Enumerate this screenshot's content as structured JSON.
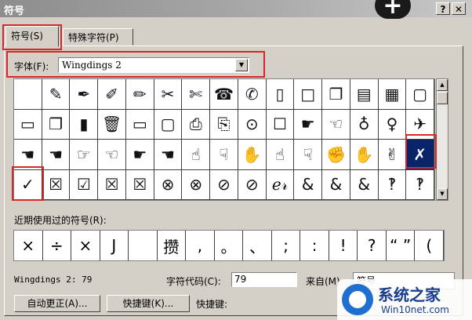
{
  "window": {
    "title": "符号",
    "help_label": "?",
    "close_label": "✕",
    "plus_label": "+"
  },
  "tabs": [
    {
      "label": "符号(S)",
      "active": true
    },
    {
      "label": "特殊字符(P)",
      "active": false
    }
  ],
  "font": {
    "label": "字体(F):",
    "value": "Wingdings 2",
    "dropdown_icon": "▼"
  },
  "symbol_grid": {
    "rows": [
      [
        " ",
        "✎",
        "✒",
        "✐",
        "✏",
        "✂",
        "✄",
        "☎",
        "✆",
        "▯",
        "□",
        "❐",
        "▤",
        "▦",
        "▢"
      ],
      [
        "▭",
        "❐",
        "▮",
        "🗑",
        "▭",
        "▢",
        "⎙",
        "⎘",
        "⊙",
        "☐",
        "☛",
        "☜",
        "♁",
        "♀",
        "✈"
      ],
      [
        "☚",
        "☚",
        "☞",
        "☜",
        "☛",
        "☚",
        "☝",
        "☟",
        "✋",
        "☝",
        "☟",
        "✊",
        "✋",
        "✌",
        "✗"
      ],
      [
        "✓",
        "☒",
        "☑",
        "☒",
        "☒",
        "⊗",
        "⊗",
        "⊘",
        "⊘",
        "ℯ𝓇",
        "&",
        "&",
        "&",
        "‽",
        "‽"
      ]
    ],
    "selected_row": 2,
    "selected_col": 14
  },
  "recent": {
    "label": "近期使用过的符号(R):",
    "symbols": [
      "×",
      "÷",
      "×",
      "J",
      " ",
      "攒",
      ",",
      "。",
      "、",
      ";",
      ":",
      "!",
      "?",
      "“ ”",
      "("
    ]
  },
  "info": {
    "font_code": "Wingdings 2: 79",
    "char_code_label": "字符代码(C):",
    "char_code_value": "79",
    "from_label": "来自(M)",
    "from_value": "符号"
  },
  "buttons": {
    "autocorrect": "自动更正(A)...",
    "shortcut_key": "快捷键(K)...",
    "shortcut_label": "快捷键:"
  },
  "watermark": {
    "text": "系统之家",
    "url": "Win10net.com"
  },
  "colors": {
    "highlight": "#d8262a",
    "selection": "#0a246a"
  }
}
